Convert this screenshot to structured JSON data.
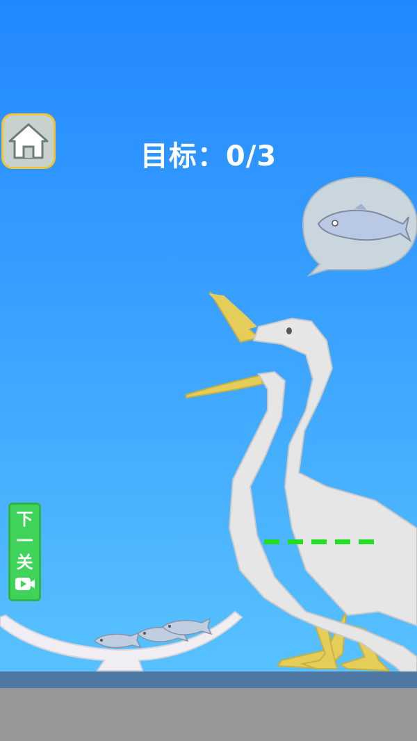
{
  "hud": {
    "goal_label": "目标：",
    "goal_value": "0/3"
  },
  "buttons": {
    "home_icon": "home-icon",
    "next_level_label": "下一关",
    "next_level_icon": "video-icon"
  },
  "speech_bubble": {
    "wants": "fish",
    "icon": "fish-icon"
  },
  "bowl": {
    "fish_count": 3
  },
  "colors": {
    "sky_top": "#2288ff",
    "sky_bottom": "#5ec8ff",
    "goal_text": "#ffffff",
    "home_border": "#f3c233",
    "next_button": "#3fd35a",
    "target_line": "#22dd22",
    "beak": "#e5cd5a",
    "goose_body": "#e6e6e6"
  }
}
